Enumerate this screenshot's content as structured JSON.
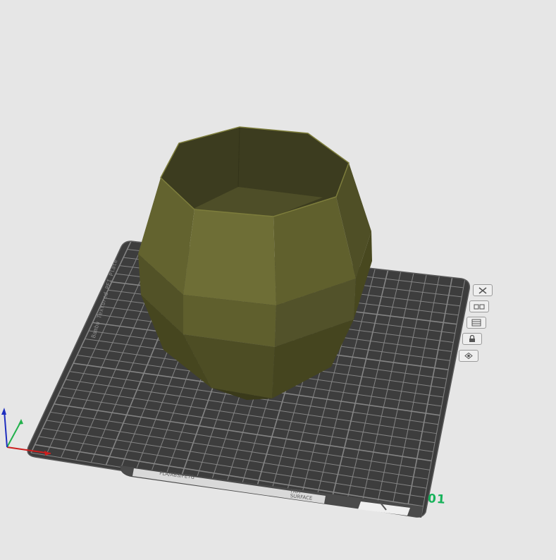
{
  "plate": {
    "number_label": "01",
    "filament_label": "PLA/ABS/PETG",
    "surface_label_line1": "HOT",
    "surface_label_line2": "SURFACE",
    "side_text": "Bambu Textured PEI Plate"
  },
  "plate_toolbar": {
    "buttons": [
      {
        "name": "delete-plate",
        "icon": "close-icon"
      },
      {
        "name": "arrange-plate",
        "icon": "arrange-icon"
      },
      {
        "name": "orient-plate",
        "icon": "orient-icon"
      },
      {
        "name": "lock-plate",
        "icon": "lock-icon"
      },
      {
        "name": "plate-settings",
        "icon": "gear-icon"
      }
    ]
  },
  "model": {
    "color": "#6b6b32"
  },
  "axes": {
    "x_color": "#cc1f1f",
    "y_color": "#22b14c",
    "z_color": "#1f2fbf"
  }
}
